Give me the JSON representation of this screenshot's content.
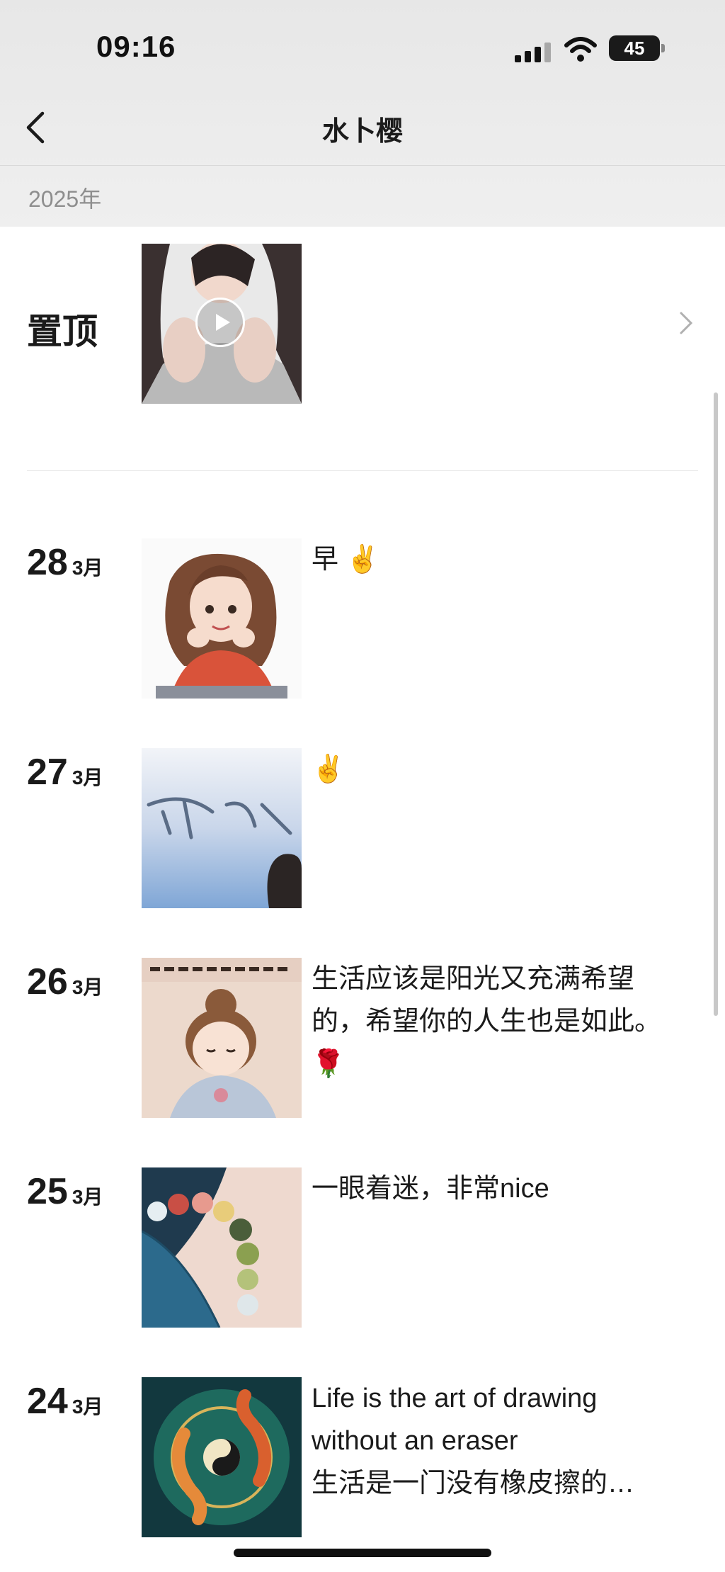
{
  "status": {
    "time": "09:16",
    "battery": "45"
  },
  "nav": {
    "title": "水卜樱"
  },
  "year_header": "2025年",
  "pinned": {
    "label": "置顶"
  },
  "posts": [
    {
      "day": "28",
      "month": "3月",
      "caption": "早 ✌️"
    },
    {
      "day": "27",
      "month": "3月",
      "caption": "✌️"
    },
    {
      "day": "26",
      "month": "3月",
      "caption": "生活应该是阳光又充满希望的，希望你的人生也是如此。🌹"
    },
    {
      "day": "25",
      "month": "3月",
      "caption": "一眼着迷，非常nice"
    },
    {
      "day": "24",
      "month": "3月",
      "caption": "Life is the art of drawing without an eraser\n 生活是一门没有橡皮擦的…"
    }
  ]
}
